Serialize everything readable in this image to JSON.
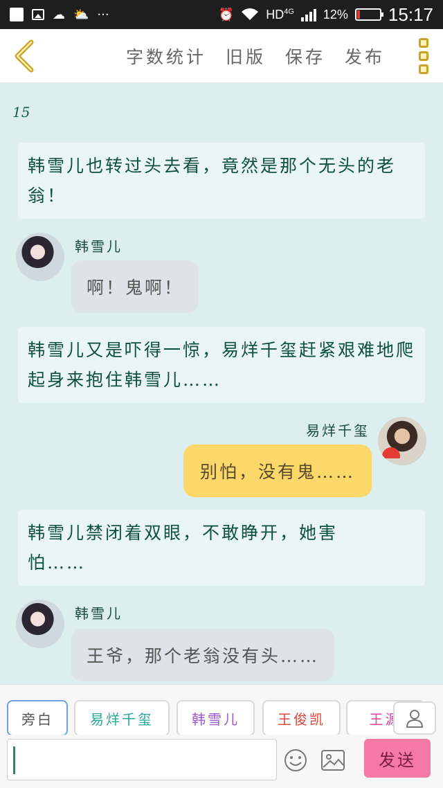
{
  "status_bar": {
    "network": "HD",
    "network_type": "4G",
    "battery": "12%",
    "battery_level": 0.12,
    "time": "15:17"
  },
  "nav": {
    "actions": [
      "字数统计",
      "旧版",
      "保存",
      "发布"
    ]
  },
  "chapter_number": "15",
  "messages": [
    {
      "type": "narration",
      "text": "韩雪儿也转过头去看，竟然是那个无头的老翁！"
    },
    {
      "type": "left",
      "speaker": "韩雪儿",
      "text": "啊！鬼啊！"
    },
    {
      "type": "narration",
      "text": "韩雪儿又是吓得一惊，易烊千玺赶紧艰难地爬起身来抱住韩雪儿……"
    },
    {
      "type": "right",
      "speaker": "易烊千玺",
      "text": "别怕，没有鬼……"
    },
    {
      "type": "narration",
      "text": "韩雪儿禁闭着双眼，不敢睁开，她害怕……"
    },
    {
      "type": "left",
      "speaker": "韩雪儿",
      "text": "王爷，那个老翁没有头……"
    }
  ],
  "roles": [
    {
      "label": "旁白",
      "color": "#555555"
    },
    {
      "label": "易烊千玺",
      "color": "#2aa79b"
    },
    {
      "label": "韩雪儿",
      "color": "#9b59c9"
    },
    {
      "label": "王俊凯",
      "color": "#e0453b"
    },
    {
      "label": "王源",
      "color": "#e0459b"
    }
  ],
  "send_label": "发送",
  "icons": {
    "back": "chevron-left-icon",
    "menu": "more-vertical-icon",
    "emoji": "smile-icon",
    "image": "image-icon",
    "user": "user-icon"
  },
  "colors": {
    "chat_bg": "#dcefee",
    "narration_bg": "#eaf6f5",
    "left_bubble": "#dde3e9",
    "right_bubble": "#fcd86a",
    "send_button": "#f47aa5",
    "accent_gold": "#c9a227"
  }
}
